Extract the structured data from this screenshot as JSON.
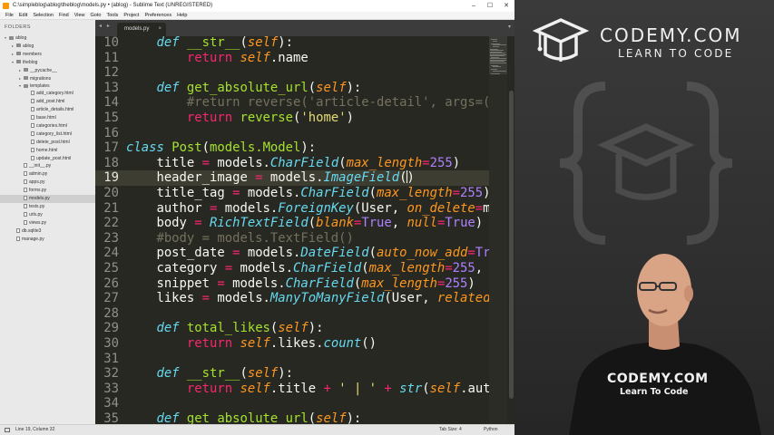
{
  "window": {
    "title": "C:\\simpleblog\\ablog\\theblog\\models.py • (ablog) - Sublime Text (UNREGISTERED)",
    "controls": [
      "–",
      "☐",
      "✕"
    ]
  },
  "menu": [
    "File",
    "Edit",
    "Selection",
    "Find",
    "View",
    "Goto",
    "Tools",
    "Project",
    "Preferences",
    "Help"
  ],
  "sidebar": {
    "heading": "FOLDERS",
    "items": [
      {
        "label": "ablog",
        "depth": 0,
        "kind": "folder",
        "open": true
      },
      {
        "label": "ablog",
        "depth": 1,
        "kind": "folder",
        "open": false
      },
      {
        "label": "members",
        "depth": 1,
        "kind": "folder",
        "open": false
      },
      {
        "label": "theblog",
        "depth": 1,
        "kind": "folder",
        "open": true
      },
      {
        "label": "__pycache__",
        "depth": 2,
        "kind": "folder",
        "open": false
      },
      {
        "label": "migrations",
        "depth": 2,
        "kind": "folder",
        "open": false
      },
      {
        "label": "templates",
        "depth": 2,
        "kind": "folder",
        "open": true
      },
      {
        "label": "add_category.html",
        "depth": 3,
        "kind": "file"
      },
      {
        "label": "add_post.html",
        "depth": 3,
        "kind": "file"
      },
      {
        "label": "article_details.html",
        "depth": 3,
        "kind": "file"
      },
      {
        "label": "base.html",
        "depth": 3,
        "kind": "file"
      },
      {
        "label": "categories.html",
        "depth": 3,
        "kind": "file"
      },
      {
        "label": "category_list.html",
        "depth": 3,
        "kind": "file"
      },
      {
        "label": "delete_post.html",
        "depth": 3,
        "kind": "file"
      },
      {
        "label": "home.html",
        "depth": 3,
        "kind": "file"
      },
      {
        "label": "update_post.html",
        "depth": 3,
        "kind": "file"
      },
      {
        "label": "__init__.py",
        "depth": 2,
        "kind": "file"
      },
      {
        "label": "admin.py",
        "depth": 2,
        "kind": "file"
      },
      {
        "label": "apps.py",
        "depth": 2,
        "kind": "file"
      },
      {
        "label": "forms.py",
        "depth": 2,
        "kind": "file"
      },
      {
        "label": "models.py",
        "depth": 2,
        "kind": "file",
        "selected": true
      },
      {
        "label": "tests.py",
        "depth": 2,
        "kind": "file"
      },
      {
        "label": "urls.py",
        "depth": 2,
        "kind": "file"
      },
      {
        "label": "views.py",
        "depth": 2,
        "kind": "file"
      },
      {
        "label": "db.sqlite3",
        "depth": 1,
        "kind": "file"
      },
      {
        "label": "manage.py",
        "depth": 1,
        "kind": "file"
      }
    ]
  },
  "tabs": {
    "nav": "◂ ▸",
    "active": "models.py",
    "close": "×",
    "dropdown": "▾"
  },
  "editor": {
    "current_line": 19,
    "lines": [
      {
        "n": "10",
        "tokens": [
          [
            "x",
            "    "
          ],
          [
            "k",
            "def"
          ],
          [
            "x",
            " "
          ],
          [
            "f",
            "__str__"
          ],
          [
            "x",
            "("
          ],
          [
            "p",
            "self"
          ],
          [
            "x",
            "):"
          ]
        ]
      },
      {
        "n": "11",
        "tokens": [
          [
            "x",
            "        "
          ],
          [
            "kw",
            "return"
          ],
          [
            "x",
            " "
          ],
          [
            "p",
            "self"
          ],
          [
            "x",
            ".name"
          ]
        ]
      },
      {
        "n": "12",
        "tokens": []
      },
      {
        "n": "13",
        "tokens": [
          [
            "x",
            "    "
          ],
          [
            "k",
            "def"
          ],
          [
            "x",
            " "
          ],
          [
            "f",
            "get_absolute_url"
          ],
          [
            "x",
            "("
          ],
          [
            "p",
            "self"
          ],
          [
            "x",
            "):"
          ]
        ]
      },
      {
        "n": "14",
        "tokens": [
          [
            "x",
            "        "
          ],
          [
            "c",
            "#return reverse('article-detail', args=(str"
          ]
        ]
      },
      {
        "n": "15",
        "tokens": [
          [
            "x",
            "        "
          ],
          [
            "kw",
            "return"
          ],
          [
            "x",
            " "
          ],
          [
            "f",
            "reverse"
          ],
          [
            "x",
            "("
          ],
          [
            "s",
            "'home'"
          ],
          [
            "x",
            ")"
          ]
        ]
      },
      {
        "n": "16",
        "tokens": []
      },
      {
        "n": "17",
        "tokens": [
          [
            "k",
            "class"
          ],
          [
            "x",
            " "
          ],
          [
            "f",
            "Post"
          ],
          [
            "x",
            "("
          ],
          [
            "f",
            "models.Model"
          ],
          [
            "x",
            "):"
          ]
        ]
      },
      {
        "n": "18",
        "tokens": [
          [
            "x",
            "    title "
          ],
          [
            "o",
            "="
          ],
          [
            "x",
            " models."
          ],
          [
            "k",
            "CharField"
          ],
          [
            "x",
            "("
          ],
          [
            "p",
            "max_length"
          ],
          [
            "o",
            "="
          ],
          [
            "n",
            "255"
          ],
          [
            "x",
            ")"
          ]
        ]
      },
      {
        "n": "19",
        "tokens": [
          [
            "x",
            "    header_image "
          ],
          [
            "o",
            "="
          ],
          [
            "x",
            " models."
          ],
          [
            "k",
            "ImageField"
          ],
          [
            "x",
            "("
          ],
          [
            "caret",
            ""
          ],
          [
            "x",
            ")"
          ]
        ]
      },
      {
        "n": "20",
        "tokens": [
          [
            "x",
            "    title_tag "
          ],
          [
            "o",
            "="
          ],
          [
            "x",
            " models."
          ],
          [
            "k",
            "CharField"
          ],
          [
            "x",
            "("
          ],
          [
            "p",
            "max_length"
          ],
          [
            "o",
            "="
          ],
          [
            "n",
            "255"
          ],
          [
            "x",
            ")"
          ]
        ]
      },
      {
        "n": "21",
        "tokens": [
          [
            "x",
            "    author "
          ],
          [
            "o",
            "="
          ],
          [
            "x",
            " models."
          ],
          [
            "k",
            "ForeignKey"
          ],
          [
            "x",
            "(User, "
          ],
          [
            "p",
            "on_delete"
          ],
          [
            "o",
            "="
          ],
          [
            "x",
            "mode"
          ]
        ]
      },
      {
        "n": "22",
        "tokens": [
          [
            "x",
            "    body "
          ],
          [
            "o",
            "="
          ],
          [
            "x",
            " "
          ],
          [
            "k",
            "RichTextField"
          ],
          [
            "x",
            "("
          ],
          [
            "p",
            "blank"
          ],
          [
            "o",
            "="
          ],
          [
            "n",
            "True"
          ],
          [
            "x",
            ", "
          ],
          [
            "p",
            "null"
          ],
          [
            "o",
            "="
          ],
          [
            "n",
            "True"
          ],
          [
            "x",
            ")"
          ]
        ]
      },
      {
        "n": "23",
        "tokens": [
          [
            "x",
            "    "
          ],
          [
            "c",
            "#body = models.TextField()"
          ]
        ]
      },
      {
        "n": "24",
        "tokens": [
          [
            "x",
            "    post_date "
          ],
          [
            "o",
            "="
          ],
          [
            "x",
            " models."
          ],
          [
            "k",
            "DateField"
          ],
          [
            "x",
            "("
          ],
          [
            "p",
            "auto_now_add"
          ],
          [
            "o",
            "="
          ],
          [
            "n",
            "True"
          ],
          [
            "x",
            ")"
          ]
        ]
      },
      {
        "n": "25",
        "tokens": [
          [
            "x",
            "    category "
          ],
          [
            "o",
            "="
          ],
          [
            "x",
            " models."
          ],
          [
            "k",
            "CharField"
          ],
          [
            "x",
            "("
          ],
          [
            "p",
            "max_length"
          ],
          [
            "o",
            "="
          ],
          [
            "n",
            "255"
          ],
          [
            "x",
            ", "
          ],
          [
            "p",
            "def"
          ]
        ]
      },
      {
        "n": "26",
        "tokens": [
          [
            "x",
            "    snippet "
          ],
          [
            "o",
            "="
          ],
          [
            "x",
            " models."
          ],
          [
            "k",
            "CharField"
          ],
          [
            "x",
            "("
          ],
          [
            "p",
            "max_length"
          ],
          [
            "o",
            "="
          ],
          [
            "n",
            "255"
          ],
          [
            "x",
            ")"
          ]
        ]
      },
      {
        "n": "27",
        "tokens": [
          [
            "x",
            "    likes "
          ],
          [
            "o",
            "="
          ],
          [
            "x",
            " models."
          ],
          [
            "k",
            "ManyToManyField"
          ],
          [
            "x",
            "(User, "
          ],
          [
            "p",
            "related_na"
          ]
        ]
      },
      {
        "n": "28",
        "tokens": []
      },
      {
        "n": "29",
        "tokens": [
          [
            "x",
            "    "
          ],
          [
            "k",
            "def"
          ],
          [
            "x",
            " "
          ],
          [
            "f",
            "total_likes"
          ],
          [
            "x",
            "("
          ],
          [
            "p",
            "self"
          ],
          [
            "x",
            "):"
          ]
        ]
      },
      {
        "n": "30",
        "tokens": [
          [
            "x",
            "        "
          ],
          [
            "kw",
            "return"
          ],
          [
            "x",
            " "
          ],
          [
            "p",
            "self"
          ],
          [
            "x",
            ".likes."
          ],
          [
            "k",
            "count"
          ],
          [
            "x",
            "()"
          ]
        ]
      },
      {
        "n": "31",
        "tokens": []
      },
      {
        "n": "32",
        "tokens": [
          [
            "x",
            "    "
          ],
          [
            "k",
            "def"
          ],
          [
            "x",
            " "
          ],
          [
            "f",
            "__str__"
          ],
          [
            "x",
            "("
          ],
          [
            "p",
            "self"
          ],
          [
            "x",
            "):"
          ]
        ]
      },
      {
        "n": "33",
        "tokens": [
          [
            "x",
            "        "
          ],
          [
            "kw",
            "return"
          ],
          [
            "x",
            " "
          ],
          [
            "p",
            "self"
          ],
          [
            "x",
            ".title "
          ],
          [
            "o",
            "+"
          ],
          [
            "x",
            " "
          ],
          [
            "s",
            "' | '"
          ],
          [
            "x",
            " "
          ],
          [
            "o",
            "+"
          ],
          [
            "x",
            " "
          ],
          [
            "k",
            "str"
          ],
          [
            "x",
            "("
          ],
          [
            "p",
            "self"
          ],
          [
            "x",
            ".author"
          ]
        ]
      },
      {
        "n": "34",
        "tokens": []
      },
      {
        "n": "35",
        "tokens": [
          [
            "x",
            "    "
          ],
          [
            "k",
            "def"
          ],
          [
            "x",
            " "
          ],
          [
            "f",
            "get_absolute_url"
          ],
          [
            "x",
            "("
          ],
          [
            "p",
            "self"
          ],
          [
            "x",
            "):"
          ]
        ]
      }
    ]
  },
  "statusbar": {
    "position": "Line 19, Column 32",
    "tab_size": "Tab Size: 4",
    "syntax": "Python"
  },
  "brand": {
    "name": "CODEMY.COM",
    "tagline": "LEARN TO CODE",
    "shirt_name": "CODEMY.COM",
    "shirt_tagline": "Learn To Code"
  },
  "colors": {
    "editor_bg": "#272822",
    "current_line_bg": "#3e3d32",
    "keyword": "#66d9ef",
    "operator": "#f92672",
    "function": "#a6e22e",
    "string": "#e6db74",
    "number": "#ae81ff",
    "param": "#fd971f",
    "comment": "#75715e"
  }
}
